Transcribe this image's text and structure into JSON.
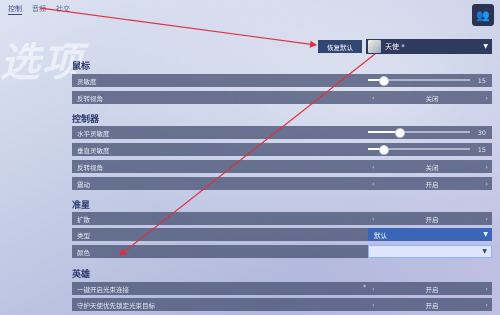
{
  "page_title": "选项",
  "top_nav": [
    "控制",
    "音频",
    "社交"
  ],
  "reset_button": "恢复默认",
  "hero_select": {
    "value": "天使"
  },
  "sections": {
    "mouse": {
      "title": "鼠标",
      "sensitivity": {
        "label": "灵敏度",
        "value": "15",
        "fraction": 0.15
      },
      "invert": {
        "label": "反转视角",
        "value": "关闭"
      }
    },
    "controller": {
      "title": "控制器",
      "h_sens": {
        "label": "水平灵敏度",
        "value": "30",
        "fraction": 0.3
      },
      "v_sens": {
        "label": "垂直灵敏度",
        "value": "15",
        "fraction": 0.15
      },
      "invert": {
        "label": "反转视角",
        "value": "关闭"
      },
      "vibration": {
        "label": "震动",
        "value": "开启"
      }
    },
    "crosshair": {
      "title": "准星",
      "enable": {
        "label": "扩散",
        "value": "开启"
      },
      "type": {
        "label": "类型",
        "value": "默认"
      },
      "color": {
        "label": "颜色"
      }
    },
    "hero": {
      "title": "英雄",
      "beam_toggle": {
        "label": "一键开启光束连接",
        "value": "开启"
      },
      "beam_priority": {
        "label": "守护天使优先锁定光束目标",
        "value": "开启"
      }
    }
  },
  "colors": {
    "annotation_arrow": "#e03040",
    "dropdown": "#3a66ba",
    "row_bg": "#4a5476"
  }
}
